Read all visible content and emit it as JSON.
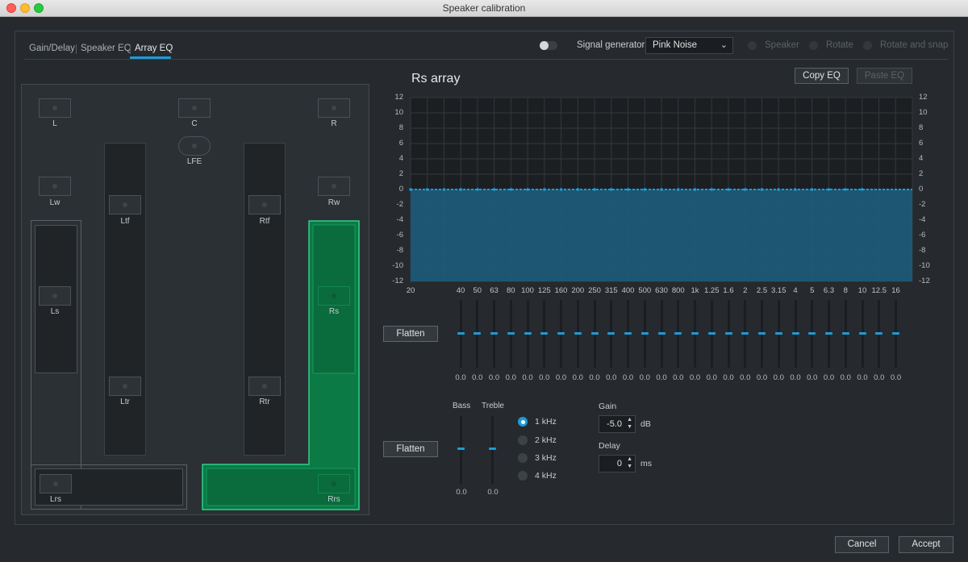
{
  "window": {
    "title": "Speaker calibration"
  },
  "tabs": [
    {
      "label": "Gain/Delay",
      "active": false
    },
    {
      "label": "Speaker EQ",
      "active": false
    },
    {
      "label": "Array EQ",
      "active": true
    }
  ],
  "header": {
    "signal_generator_label": "Signal generator",
    "signal_generator_value": "Pink Noise",
    "signal_generator_enabled": false,
    "modes": [
      "Speaker",
      "Rotate",
      "Rotate and snap"
    ]
  },
  "layout_panel": {
    "speakers": {
      "L": "L",
      "C": "C",
      "R": "R",
      "LFE": "LFE",
      "Lw": "Lw",
      "Rw": "Rw",
      "Ltf": "Ltf",
      "Rtf": "Rtf",
      "Ls": "Ls",
      "Rs": "Rs",
      "Ltr": "Ltr",
      "Rtr": "Rtr",
      "Lrs": "Lrs",
      "Rrs": "Rrs"
    },
    "selected_array": "Rs array",
    "colors": {
      "selected": "#0b7a45",
      "selected_border": "#2fd08a"
    }
  },
  "eq": {
    "title": "Rs array",
    "copy_label": "Copy EQ",
    "paste_label": "Paste EQ",
    "flatten_label": "Flatten",
    "y_ticks": [
      "12",
      "10",
      "8",
      "6",
      "4",
      "2",
      "0",
      "-2",
      "-4",
      "-6",
      "-8",
      "-10",
      "-12"
    ],
    "fill_color": "#1d5a78",
    "line_color": "#1e9bd7"
  },
  "chart_data": {
    "type": "area",
    "ylim": [
      -12,
      12
    ],
    "x": [
      "20",
      "40",
      "50",
      "63",
      "80",
      "100",
      "125",
      "160",
      "200",
      "250",
      "315",
      "400",
      "500",
      "630",
      "800",
      "1k",
      "1.25",
      "1.6",
      "2",
      "2.5",
      "3.15",
      "4",
      "5",
      "6.3",
      "8",
      "10",
      "12.5",
      "16"
    ],
    "y": [
      0,
      0,
      0,
      0,
      0,
      0,
      0,
      0,
      0,
      0,
      0,
      0,
      0,
      0,
      0,
      0,
      0,
      0,
      0,
      0,
      0,
      0,
      0,
      0,
      0,
      0,
      0,
      0
    ],
    "grid": true
  },
  "band_sliders": {
    "labels": [
      "40",
      "50",
      "63",
      "80",
      "100",
      "125",
      "160",
      "200",
      "250",
      "315",
      "400",
      "500",
      "630",
      "800",
      "1k",
      "1.25",
      "1.6",
      "2",
      "2.5",
      "3.15",
      "4",
      "5",
      "6.3",
      "8",
      "10",
      "12.5",
      "16"
    ],
    "values": [
      "0.0",
      "0.0",
      "0.0",
      "0.0",
      "0.0",
      "0.0",
      "0.0",
      "0.0",
      "0.0",
      "0.0",
      "0.0",
      "0.0",
      "0.0",
      "0.0",
      "0.0",
      "0.0",
      "0.0",
      "0.0",
      "0.0",
      "0.0",
      "0.0",
      "0.0",
      "0.0",
      "0.0",
      "0.0",
      "0.0",
      "0.0"
    ]
  },
  "tone": {
    "bass_label": "Bass",
    "treble_label": "Treble",
    "bass_value": "0.0",
    "treble_value": "0.0",
    "flatten_label": "Flatten",
    "freqs": [
      {
        "label": "1 kHz",
        "selected": true
      },
      {
        "label": "2 kHz",
        "selected": false
      },
      {
        "label": "3 kHz",
        "selected": false
      },
      {
        "label": "4 kHz",
        "selected": false
      }
    ],
    "gain_label": "Gain",
    "gain_value": "-5.0",
    "gain_unit": "dB",
    "delay_label": "Delay",
    "delay_value": "0",
    "delay_unit": "ms"
  },
  "footer": {
    "cancel_label": "Cancel",
    "accept_label": "Accept"
  }
}
